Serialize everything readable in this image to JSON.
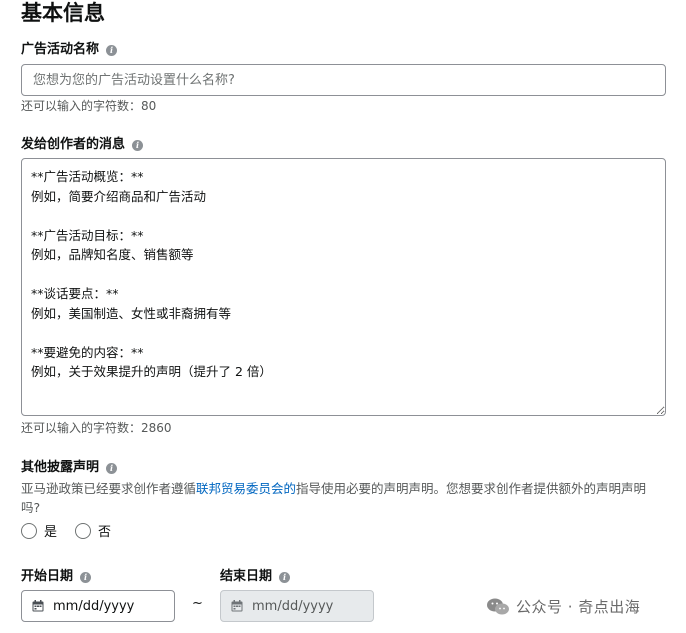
{
  "section": {
    "title": "基本信息"
  },
  "campaign_name": {
    "label": "广告活动名称",
    "info_icon": "info-icon",
    "placeholder": "您想为您的广告活动设置什么名称?",
    "helper": "还可以输入的字符数：80"
  },
  "creator_message": {
    "label": "发给创作者的消息",
    "info_icon": "info-icon",
    "value": "**广告活动概览：**\n例如，简要介绍商品和广告活动\n\n**广告活动目标：**\n例如，品牌知名度、销售额等\n\n**谈话要点：**\n例如，美国制造、女性或非裔拥有等\n\n**要避免的内容：**\n例如，关于效果提升的声明（提升了 2 倍）",
    "helper": "还可以输入的字符数：2860"
  },
  "disclosure": {
    "label": "其他披露声明",
    "info_icon": "info-icon",
    "desc_before": "亚马逊政策已经要求创作者遵循",
    "desc_link": "联邦贸易委员会的",
    "desc_after": "指导使用必要的声明声明。您想要求创作者提供额外的声明声明吗?",
    "options": [
      "是",
      "否"
    ]
  },
  "dates": {
    "start_label": "开始日期",
    "end_label": "结束日期",
    "start_placeholder": "mm/dd/yyyy",
    "end_placeholder": "mm/dd/yyyy",
    "separator": "~",
    "calendar_icon": "calendar-icon"
  },
  "watermark": {
    "text": "公众号 · 奇点出海",
    "icon": "wechat-icon"
  },
  "colors": {
    "link": "#0066c0",
    "border": "#8d9096",
    "helper": "#565959",
    "disabled_bg": "#e7eaec"
  }
}
